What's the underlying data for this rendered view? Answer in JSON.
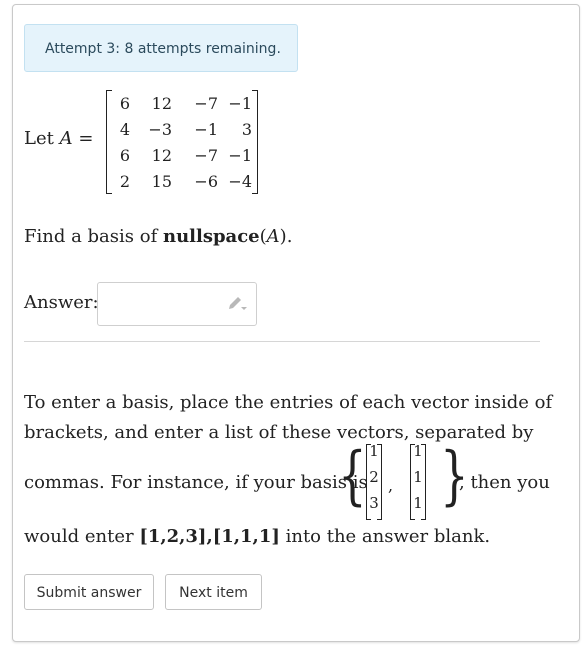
{
  "alert": {
    "text": "Attempt 3: 8 attempts remaining."
  },
  "question": {
    "let_prefix": "Let",
    "matrix_name": "A",
    "equals": "=",
    "matrix": [
      [
        "6",
        "12",
        "−7",
        "−1"
      ],
      [
        "4",
        "−3",
        "−1",
        "3"
      ],
      [
        "6",
        "12",
        "−7",
        "−1"
      ],
      [
        "2",
        "15",
        "−6",
        "−4"
      ]
    ],
    "find_prefix": "Find a basis of",
    "find_bold": "nullspace",
    "find_paren_open": "(",
    "find_var": "A",
    "find_suffix": ")."
  },
  "answer": {
    "label": "Answer:",
    "value": "",
    "icon": "pencil-icon"
  },
  "instructions": {
    "line1": "To enter a basis, place the entries of each vector inside of",
    "line2": "brackets, and enter a list of these vectors, separated by",
    "line3_prefix": "commas. For instance, if your basis is",
    "line3_suffix": ", then you",
    "example_vectors": [
      [
        "1",
        "2",
        "3"
      ],
      [
        "1",
        "1",
        "1"
      ]
    ],
    "example_comma": ",",
    "line4_prefix": "would enter",
    "line4_code": "[1,2,3],[1,1,1]",
    "line4_suffix": "into the answer blank."
  },
  "buttons": {
    "submit": "Submit answer",
    "next": "Next item"
  }
}
